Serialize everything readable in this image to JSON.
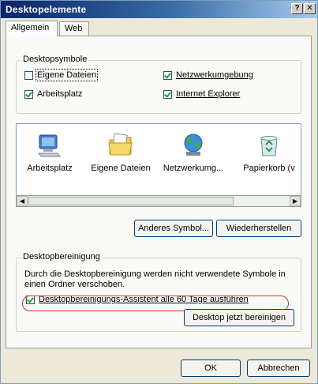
{
  "window": {
    "title": "Desktopelemente",
    "help": "?",
    "close": "✕"
  },
  "tabs": [
    {
      "label": "Allgemein"
    },
    {
      "label": "Web"
    }
  ],
  "desktop_icons": {
    "title": "Desktopsymbole",
    "checkboxes": [
      {
        "label": "Eigene Dateien",
        "checked": false
      },
      {
        "label": "Netzwerkumgebung",
        "checked": true
      },
      {
        "label": "Arbeitsplatz",
        "checked": true
      },
      {
        "label": "Internet Explorer",
        "checked": true
      }
    ]
  },
  "icon_list": [
    {
      "label": "Arbeitsplatz",
      "icon": "computer-icon"
    },
    {
      "label": "Eigene Dateien",
      "icon": "documents-folder-icon"
    },
    {
      "label": "Netzwerkumg...",
      "icon": "network-globe-icon"
    },
    {
      "label": "Papierkorb (v",
      "icon": "recycle-bin-icon"
    }
  ],
  "buttons": {
    "change_icon": "Anderes Symbol...",
    "restore_default": "Wiederherstellen",
    "cleanup_now": "Desktop jetzt bereinigen",
    "ok": "OK",
    "cancel": "Abbrechen"
  },
  "cleanup": {
    "title": "Desktopbereinigung",
    "description": "Durch die Desktopbereinigung werden nicht verwendete Symbole in einen Ordner verschoben.",
    "checkbox_label": "Desktopbereinigungs-Assistent alle 60 Tage ausführen",
    "checked": true
  },
  "colors": {
    "highlight_ellipse": "#d83030",
    "title_bar": "#0a246a"
  }
}
